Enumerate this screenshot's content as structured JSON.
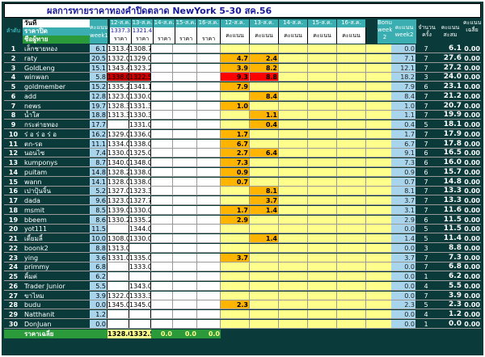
{
  "title": "ผลการทายราคาทองคำปิดตลาด NewYork 5-30 สค.56",
  "header": {
    "rank": "ลำดับ",
    "date_label": "วันที่",
    "close_label": "ราคาปิด",
    "player_label": "ชื่อผู้ทาย",
    "w1_score": "คะแนน week1",
    "dates": [
      "12-ส.ค.",
      "13-ส.ค.",
      "14-ส.ค.",
      "15-ส.ค.",
      "16-ส.ค.",
      "12-ส.ค.",
      "13-ส.ค.",
      "14-ส.ค.",
      "15-ส.ค.",
      "16-ส.ค."
    ],
    "close_values": [
      "1337.3",
      "1321.4",
      "",
      "",
      ""
    ],
    "price_word": "ราคา",
    "score_word": "คะแนน",
    "bonus": "Bonus week 2",
    "w2_score": "คะแนน week2",
    "count": "จำนวนครั้ง",
    "total": "คะแนนสะสม",
    "avg": "คะแนนเฉลี่ย"
  },
  "rows": [
    [
      "1",
      "เล็กชายทอง",
      "6.1",
      "1313.4",
      "1308.7",
      "",
      "",
      "",
      "",
      "",
      "",
      "",
      "",
      "",
      "0.0",
      "7",
      "6.1",
      "0.00"
    ],
    [
      "2",
      "raty",
      "20.5",
      "1332.0",
      "1329.0",
      "",
      "",
      "",
      "4.7",
      "2.4",
      "",
      "",
      "",
      "",
      "7.1",
      "7",
      "27.6",
      "0.00"
    ],
    [
      "3",
      "GoldLeng",
      "15.1",
      "1343.4",
      "1323.2",
      "",
      "",
      "",
      "3.9",
      "8.2",
      "",
      "",
      "",
      "",
      "12.1",
      "7",
      "27.2",
      "0.00"
    ],
    [
      "4",
      "winwan",
      "5.8",
      "1338.0",
      "1322.5",
      "",
      "",
      "",
      "9.3",
      "8.8",
      "",
      "",
      "",
      "",
      "18.2",
      "3",
      "24.0",
      "0.00"
    ],
    [
      "5",
      "goldmember",
      "15.2",
      "1335.2",
      "1341.1",
      "",
      "",
      "",
      "7.9",
      "",
      "",
      "",
      "",
      "",
      "7.9",
      "6",
      "23.1",
      "0.00"
    ],
    [
      "6",
      "add",
      "12.8",
      "1323.0",
      "1330.0",
      "",
      "",
      "",
      "",
      "8.4",
      "",
      "",
      "",
      "",
      "8.4",
      "7",
      "21.2",
      "0.00"
    ],
    [
      "7",
      "news",
      "19.7",
      "1328.3",
      "1331.3",
      "",
      "",
      "",
      "1.0",
      "",
      "",
      "",
      "",
      "",
      "1.0",
      "7",
      "20.7",
      "0.00"
    ],
    [
      "8",
      "น้ำใส",
      "18.8",
      "1313.3",
      "1330.3",
      "",
      "",
      "",
      "",
      "1.1",
      "",
      "",
      "",
      "",
      "1.1",
      "7",
      "19.9",
      "0.00"
    ],
    [
      "9",
      "กระต่ายทอง",
      "17.7",
      "",
      "1331.0",
      "",
      "",
      "",
      "",
      "0.4",
      "",
      "",
      "",
      "",
      "0.4",
      "5",
      "18.1",
      "0.00"
    ],
    [
      "10",
      "ร่ อ ร่ อ ร่ อ",
      "16.2",
      "1329.0",
      "1336.0",
      "",
      "",
      "",
      "1.7",
      "",
      "",
      "",
      "",
      "",
      "1.7",
      "7",
      "17.9",
      "0.00"
    ],
    [
      "11",
      "ตก-รด",
      "11.1",
      "1334.0",
      "1338.0",
      "",
      "",
      "",
      "6.7",
      "",
      "",
      "",
      "",
      "",
      "6.7",
      "7",
      "17.8",
      "0.00"
    ],
    [
      "12",
      "นอนไซ",
      "7.4",
      "1330.0",
      "1325.0",
      "",
      "",
      "",
      "2.7",
      "6.4",
      "",
      "",
      "",
      "",
      "9.1",
      "6",
      "16.5",
      "0.00"
    ],
    [
      "13",
      "kumponys",
      "8.7",
      "1340.0",
      "1348.0",
      "",
      "",
      "",
      "7.3",
      "",
      "",
      "",
      "",
      "",
      "7.3",
      "6",
      "16.0",
      "0.00"
    ],
    [
      "14",
      "puitam",
      "14.8",
      "1328.2",
      "1338.0",
      "",
      "",
      "",
      "0.9",
      "",
      "",
      "",
      "",
      "",
      "0.9",
      "6",
      "15.7",
      "0.00"
    ],
    [
      "15",
      "wann",
      "14.1",
      "1328.0",
      "1338.0",
      "",
      "",
      "",
      "0.7",
      "",
      "",
      "",
      "",
      "",
      "0.7",
      "7",
      "14.8",
      "0.00"
    ],
    [
      "16",
      "เปาปุ้นจิ้น",
      "5.2",
      "1327.0",
      "1323.3",
      "",
      "",
      "",
      "",
      "8.1",
      "",
      "",
      "",
      "",
      "8.1",
      "7",
      "13.3",
      "0.00"
    ],
    [
      "17",
      "dada",
      "9.6",
      "1323.0",
      "1327.7",
      "",
      "",
      "",
      "",
      "3.7",
      "",
      "",
      "",
      "",
      "3.7",
      "7",
      "13.3",
      "0.00"
    ],
    [
      "18",
      "msmit",
      "8.5",
      "1339.0",
      "1330.0",
      "",
      "",
      "",
      "1.7",
      "1.4",
      "",
      "",
      "",
      "",
      "3.1",
      "7",
      "11.6",
      "0.00"
    ],
    [
      "19",
      "bbeem",
      "8.6",
      "1330.2",
      "1335.2",
      "",
      "",
      "",
      "2.9",
      "",
      "",
      "",
      "",
      "",
      "2.9",
      "6",
      "11.5",
      "0.00"
    ],
    [
      "20",
      "yot111",
      "11.5",
      "",
      "1344.0",
      "",
      "",
      "",
      "",
      "",
      "",
      "",
      "",
      "",
      "0.0",
      "5",
      "11.5",
      "0.00"
    ],
    [
      "21",
      "เดี้ยมลี้",
      "10.0",
      "1308.0",
      "1330.0",
      "",
      "",
      "",
      "",
      "1.4",
      "",
      "",
      "",
      "",
      "1.4",
      "5",
      "11.4",
      "0.00"
    ],
    [
      "22",
      "boonk2",
      "8.8",
      "1313.0",
      "",
      "",
      "",
      "",
      "",
      "",
      "",
      "",
      "",
      "",
      "0.0",
      "3",
      "8.8",
      "0.00"
    ],
    [
      "23",
      "ying",
      "3.6",
      "1331.0",
      "1335.0",
      "",
      "",
      "",
      "3.7",
      "",
      "",
      "",
      "",
      "",
      "3.7",
      "7",
      "7.3",
      "0.00"
    ],
    [
      "24",
      "primmy",
      "6.8",
      "",
      "1333.0",
      "",
      "",
      "",
      "",
      "",
      "",
      "",
      "",
      "",
      "0.0",
      "7",
      "6.8",
      "0.00"
    ],
    [
      "25",
      "คิ้มค่",
      "6.2",
      "",
      "",
      "",
      "",
      "",
      "",
      "",
      "",
      "",
      "",
      "",
      "0.0",
      "1",
      "6.2",
      "0.00"
    ],
    [
      "26",
      "Trader Junior",
      "5.5",
      "",
      "1343.0",
      "",
      "",
      "",
      "",
      "",
      "",
      "",
      "",
      "",
      "0.0",
      "4",
      "5.5",
      "0.00"
    ],
    [
      "27",
      "ขาไหม",
      "3.9",
      "1322.0",
      "1333.3",
      "",
      "",
      "",
      "",
      "",
      "",
      "",
      "",
      "",
      "0.0",
      "7",
      "3.9",
      "0.00"
    ],
    [
      "28",
      "budu",
      "0.0",
      "1345.0",
      "1345.0",
      "",
      "",
      "",
      "2.3",
      "",
      "",
      "",
      "",
      "",
      "2.3",
      "5",
      "2.3",
      "0.00"
    ],
    [
      "29",
      "Natthanit",
      "1.2",
      "",
      "",
      "",
      "",
      "",
      "",
      "",
      "",
      "",
      "",
      "",
      "0.0",
      "4",
      "1.2",
      "0.00"
    ],
    [
      "30",
      "DonJuan",
      "0.0",
      "",
      "",
      "",
      "",
      "",
      "",
      "",
      "",
      "",
      "",
      "",
      "0.0",
      "1",
      "0.0",
      "0.00"
    ]
  ],
  "footer": [
    "",
    "ราคาเฉลี่ย",
    "",
    "1328.0",
    "1332.5",
    "0.0",
    "0.0",
    "0.0"
  ],
  "colors": {
    "bg": "#0a3a3a",
    "teal": "#3aaeb0",
    "yellow": "#ffff8c",
    "orange": "#ffb400",
    "red": "#ff0000",
    "lightblue": "#a9d5ec",
    "green": "#2b9a3a"
  }
}
